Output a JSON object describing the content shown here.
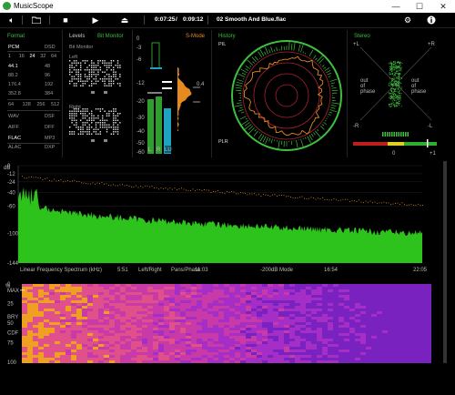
{
  "app": {
    "title": "MusicScope"
  },
  "window_buttons": {
    "minimize": "—",
    "maximize": "☐",
    "close": "✕"
  },
  "toolbar": {
    "time_elapsed": "0:07:25",
    "time_separator": "/",
    "time_total": "0:09:12",
    "track": "02 Smooth And Blue.flac"
  },
  "panels": {
    "format": {
      "title": "Format",
      "rows": [
        [
          "PCM",
          "DSD"
        ],
        [
          "1",
          "16",
          "24",
          "32",
          "64"
        ],
        [
          "44.1",
          "48"
        ],
        [
          "88.2",
          "96"
        ],
        [
          "176.4",
          "192"
        ],
        [
          "352.8",
          "384"
        ],
        [
          "64",
          "128",
          "256",
          "512"
        ],
        [
          "WAV",
          "DSF"
        ],
        [
          "AIFF",
          "DFF"
        ],
        [
          "FLAC",
          "MP3"
        ],
        [
          "ALAC",
          "DXP"
        ]
      ]
    },
    "levels": {
      "title": "Levels",
      "bit_monitor_tab": "Bit Monitor",
      "bit_monitor_label": "Bit Monitor",
      "left_label": "Left",
      "right_label": "Right",
      "peak_label": "0.4",
      "scale": [
        "0",
        "-3",
        "-6",
        "-12",
        "-20",
        "-30",
        "-40",
        "-50",
        "-60"
      ],
      "channels": [
        "L",
        "R",
        "LU"
      ]
    },
    "s_mode": {
      "title": "S-Mode"
    },
    "history": {
      "title": "History",
      "pr_label": "PIL",
      "plr_label": "PLR"
    },
    "stereo": {
      "title": "Stereo",
      "plus_l": "+L",
      "plus_r": "+R",
      "minus_l": "-R",
      "minus_r": "-L",
      "out_phase_left": "out of phase",
      "out_phase_right": "out of phase",
      "corr_zero": "0",
      "corr_plus": "+1"
    }
  },
  "spectrum": {
    "db_label": "dB",
    "y_ticks": [
      "0",
      "-12",
      "-24",
      "-40",
      "-60",
      "-100",
      "-144"
    ],
    "x_ticks": [
      "5:51",
      "11:03",
      "16:54",
      "22:05"
    ],
    "mode_label": "Linear Frequency Spectrum (kHz)",
    "option_lr": "Left/Right",
    "option_phase": "Pans/Phase",
    "option_mode": "-200dB Mode"
  },
  "spectrogram": {
    "pct_label": "%",
    "y_ticks": [
      "0",
      "MAX",
      "25",
      "BRY",
      "50",
      "CDF",
      "75",
      "100"
    ]
  },
  "colors": {
    "accent": "#3fbf3f",
    "orange": "#e68a1f",
    "cyan": "#1fa3c2",
    "spectrum_green": "#2ec21d"
  }
}
